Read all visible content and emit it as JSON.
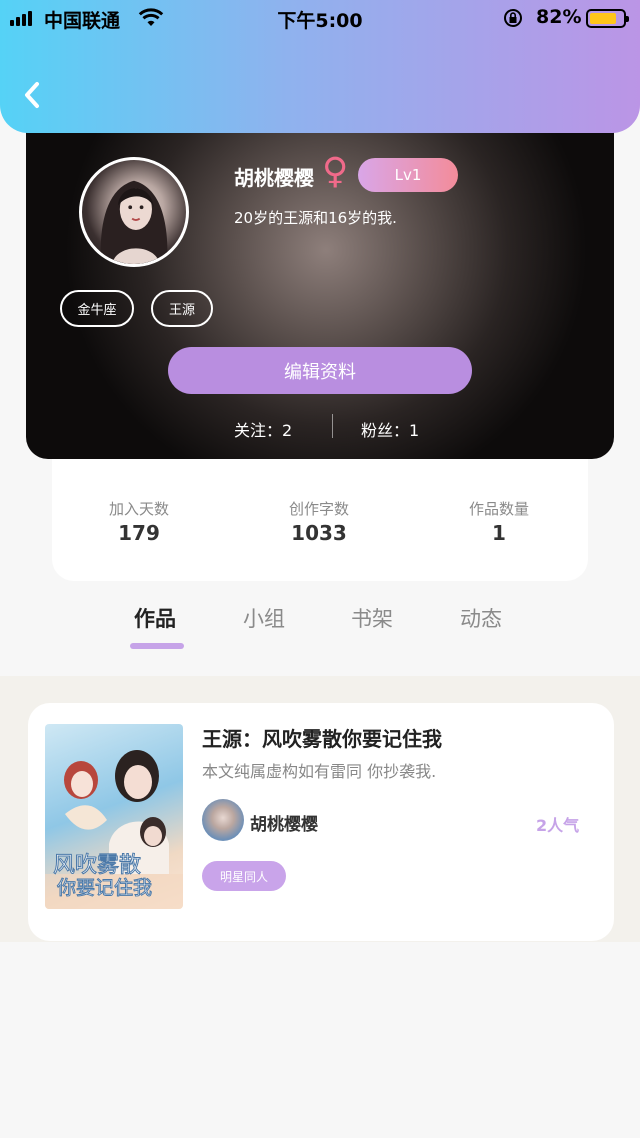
{
  "status_bar": {
    "carrier": "中国联通",
    "time": "下午5:00",
    "battery_percent": "82%",
    "battery_level": 0.82,
    "icons": [
      "signal-icon",
      "wifi-icon",
      "rotation-lock-icon",
      "battery-icon"
    ]
  },
  "header": {
    "back_icon": "chevron-left-icon"
  },
  "profile": {
    "name": "胡桃樱樱",
    "gender_symbol": "♀",
    "level": "Lv1",
    "bio": "20岁的王源和16岁的我.",
    "tags": [
      "金牛座",
      "王源"
    ],
    "edit_button": "编辑资料",
    "following": "关注：2",
    "followers": "粉丝：1"
  },
  "stats": [
    {
      "label": "加入天数",
      "value": "179"
    },
    {
      "label": "创作字数",
      "value": "1033"
    },
    {
      "label": "作品数量",
      "value": "1"
    }
  ],
  "tabs": [
    {
      "label": "作品",
      "active": true
    },
    {
      "label": "小组",
      "active": false
    },
    {
      "label": "书架",
      "active": false
    },
    {
      "label": "动态",
      "active": false
    }
  ],
  "works": [
    {
      "title": "王源：风吹雾散你要记住我",
      "description": "本文纯属虚构如有雷同 你抄袭我.",
      "author": "胡桃樱樱",
      "popularity": "2人气",
      "category": "明星同人",
      "cover_text_line1": "风吹雾散",
      "cover_text_line2": "你要记住我"
    }
  ],
  "colors": {
    "header_gradient_start": "#55d2f6",
    "header_gradient_end": "#bb95e6",
    "accent_purple": "#b98ee0",
    "tab_indicator": "#c6a3e8",
    "gender_pink": "#f06a8a"
  }
}
